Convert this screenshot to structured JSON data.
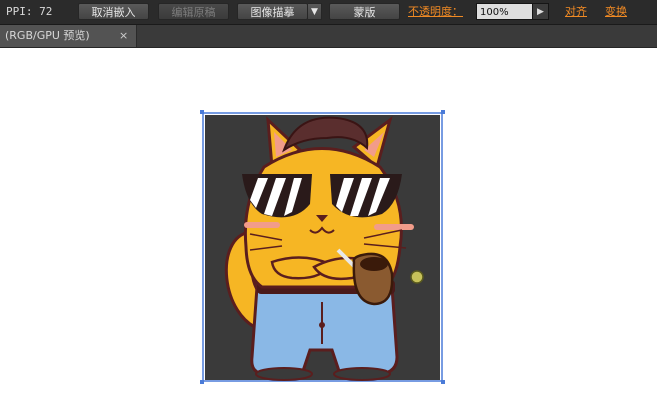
{
  "toolbar": {
    "ppi": "PPI: 72",
    "unembed_label": "取消嵌入",
    "edit_original_label": "编辑原稿",
    "image_trace_label": "图像描摹",
    "mask_label": "蒙版",
    "opacity_label": "不透明度：",
    "opacity_value": "100%",
    "align_label": "对齐",
    "transform_label": "变换"
  },
  "tab": {
    "label": "(RGB/GPU 预览)",
    "close": "×"
  },
  "colors": {
    "toolbar_bg": "#2b2b2b",
    "link_orange": "#f08a24",
    "selection_blue": "#4a7bd8",
    "artwork_bg": "#3a3a3a"
  }
}
